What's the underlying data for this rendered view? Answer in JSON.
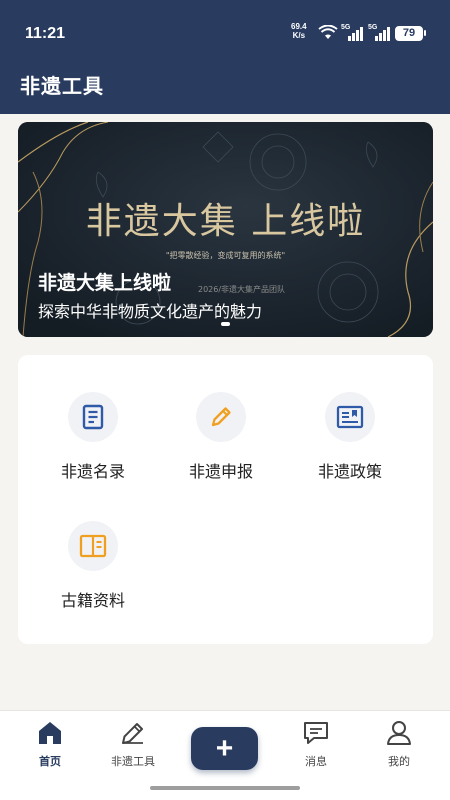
{
  "status_bar": {
    "time": "11:21",
    "net_speed_value": "69.4",
    "net_speed_unit": "K/s",
    "sig1": "5G",
    "sig2": "5G",
    "battery": "79"
  },
  "header": {
    "title": "非遗工具",
    "bg_color": "#293c60"
  },
  "banner": {
    "hero_text": "非遗大集 上线啦",
    "quote": "\"把零散经验，变成可复用的系统\"",
    "team": "2026/非遗大集产品团队",
    "title": "非遗大集上线啦",
    "subtitle": "探索中华非物质文化遗产的魅力"
  },
  "grid": {
    "items": [
      {
        "label": "非遗名录",
        "icon": "document-list-icon",
        "color": "#2f5aa8"
      },
      {
        "label": "非遗申报",
        "icon": "pencil-icon",
        "color": "#f0a020"
      },
      {
        "label": "非遗政策",
        "icon": "newspaper-icon",
        "color": "#2f5aa8"
      },
      {
        "label": "古籍资料",
        "icon": "book-icon",
        "color": "#f0a020"
      }
    ]
  },
  "tabbar": {
    "tabs": [
      {
        "label": "首页",
        "icon": "home-icon",
        "active": true
      },
      {
        "label": "非遗工具",
        "icon": "pencil-icon",
        "active": false
      },
      {
        "label": "消息",
        "icon": "message-icon",
        "active": false
      },
      {
        "label": "我的",
        "icon": "user-icon",
        "active": false
      }
    ],
    "center_label": "+"
  },
  "accent_color": "#293c60"
}
